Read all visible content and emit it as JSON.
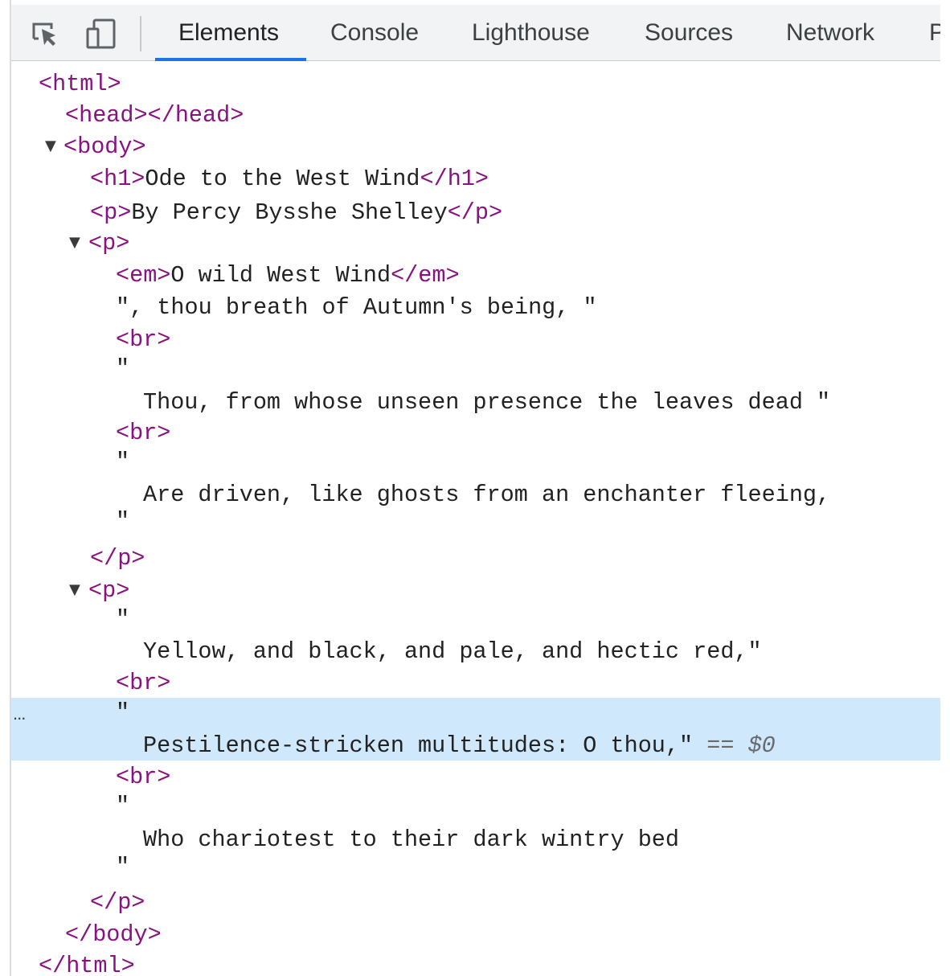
{
  "toolbar": {
    "icons": [
      "inspect-element-icon",
      "device-toolbar-icon"
    ],
    "tabs": [
      {
        "label": "Elements",
        "active": true
      },
      {
        "label": "Console"
      },
      {
        "label": "Lighthouse"
      },
      {
        "label": "Sources"
      },
      {
        "label": "Network"
      },
      {
        "label": "P"
      }
    ],
    "accent_color": "#1a73e8"
  },
  "tree": {
    "html_open": "<html>",
    "head": "<head></head>",
    "body_open": "<body>",
    "h1_open": "<h1>",
    "h1_text": "Ode to the West Wind",
    "h1_close": "</h1>",
    "p1_open": "<p>",
    "p1_text": "By Percy Bysshe Shelley",
    "p1_close": "</p>",
    "p2_open": "<p>",
    "em_open": "<em>",
    "em_text": "O wild West Wind",
    "em_close": "</em>",
    "line_thou": "\", thou breath of Autumn's being, \"",
    "br": "<br>",
    "quote": "\"",
    "line_leaves": "Thou, from whose unseen presence the leaves dead \"",
    "line_driven": "Are driven, like ghosts from an enchanter fleeing,",
    "p_close": "</p>",
    "p3_open": "<p>",
    "line_yellow": "Yellow, and black, and pale, and hectic red,\"",
    "line_pestilence": "Pestilence-stricken multitudes: O thou,\"",
    "selected_marker": "==",
    "selected_var": "$0",
    "ellipsis": "...",
    "line_who": "Who chariotest to their dark wintry bed",
    "body_close": "</body>",
    "html_close": "</html>"
  },
  "colors": {
    "tag": "#881280",
    "selected_row": "#cfe8fc"
  }
}
